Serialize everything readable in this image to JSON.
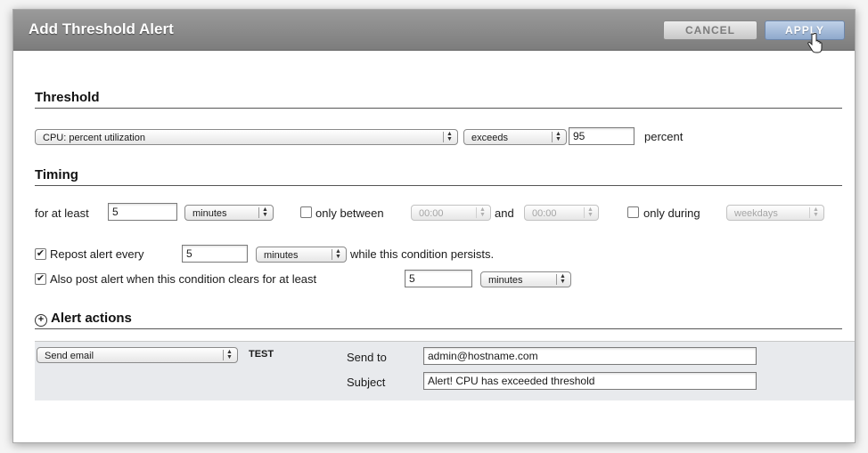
{
  "dialog": {
    "title": "Add Threshold Alert",
    "cancel_label": "CANCEL",
    "apply_label": "APPLY"
  },
  "threshold": {
    "heading": "Threshold",
    "metric": "CPU: percent utilization",
    "operator": "exceeds",
    "value": "95",
    "unit": "percent"
  },
  "timing": {
    "heading": "Timing",
    "for_at_least_label": "for at least",
    "for_at_least_value": "5",
    "for_at_least_unit": "minutes",
    "only_between_label": "only between",
    "between_start": "00:00",
    "and_label": "and",
    "between_end": "00:00",
    "only_during_label": "only during",
    "during_value": "weekdays",
    "repost_label": "Repost alert every",
    "repost_value": "5",
    "repost_unit": "minutes",
    "repost_suffix": "while this condition persists.",
    "clear_label": "Also post alert when this condition clears for at least",
    "clear_value": "5",
    "clear_unit": "minutes",
    "only_between_checked": false,
    "only_during_checked": false,
    "repost_checked": true,
    "clear_checked": true
  },
  "actions": {
    "heading": "Alert actions",
    "add_icon": "plus-circle-icon",
    "action_type": "Send email",
    "test_label": "TEST",
    "send_to_label": "Send to",
    "send_to_value": "admin@hostname.com",
    "subject_label": "Subject",
    "subject_value": "Alert! CPU has exceeded threshold"
  },
  "colors": {
    "titlebar": "#8a8a8a",
    "apply_button": "#9fb6d6",
    "actions_panel": "#e8eaed"
  }
}
